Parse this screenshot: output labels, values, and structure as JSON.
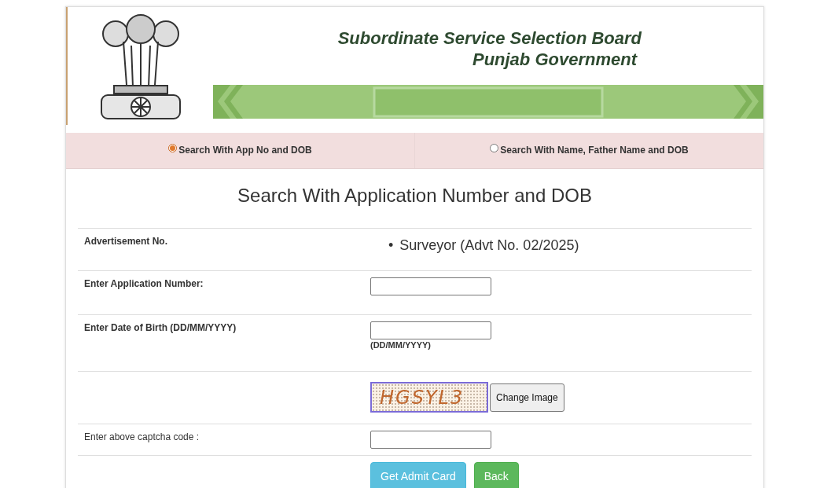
{
  "header": {
    "title": "Subordinate Service Selection Board",
    "subtitle": "Punjab Government"
  },
  "search_modes": [
    {
      "label": "Search With App No and DOB",
      "selected": true
    },
    {
      "label": "Search With Name, Father Name and DOB",
      "selected": false
    }
  ],
  "heading": "Search With Application Number and DOB",
  "form_rows": [
    {
      "kind": "list",
      "label": "Advertisement No.",
      "label_bold": true,
      "items": [
        {
          "bullet": "•",
          "text": "Surveyor (Advt No. 02/2025)"
        }
      ]
    },
    {
      "kind": "input",
      "label": "Enter Application Number:",
      "label_bold": true
    },
    {
      "kind": "input",
      "label": "Enter Date of Birth (DD/MM/YYYY)",
      "label_bold": true,
      "hint": "(DD/MM/YYYY)"
    },
    {
      "kind": "captcha",
      "captcha": "HGSYL3",
      "button": "Change Image"
    },
    {
      "kind": "input",
      "label": "Enter above captcha code :",
      "label_bold": false
    },
    {
      "kind": "buttons",
      "buttons": [
        {
          "label": "Get Admit Card",
          "kind": "info"
        },
        {
          "label": "Back",
          "kind": "success"
        }
      ]
    }
  ]
}
